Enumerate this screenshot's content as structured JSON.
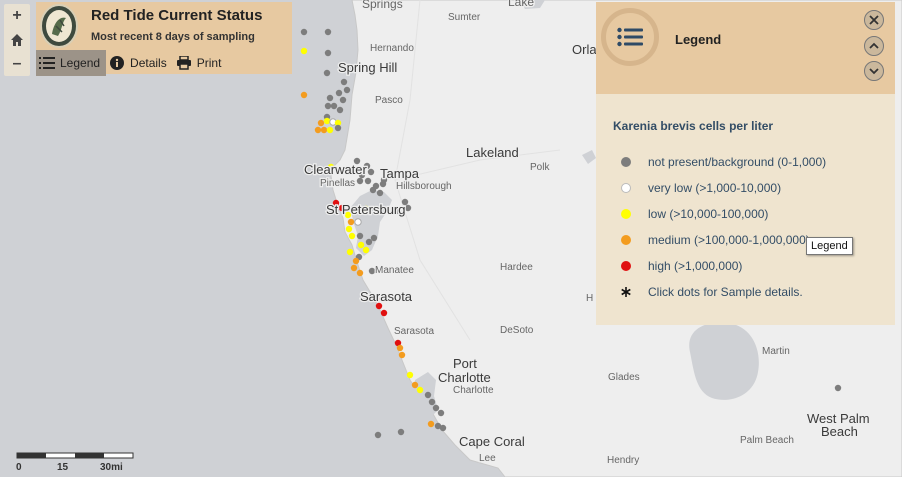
{
  "header": {
    "title": "Red Tide Current Status",
    "subtitle": "Most recent 8 days of sampling",
    "tabs": [
      {
        "label": "Legend",
        "icon": "list-icon",
        "active": true
      },
      {
        "label": "Details",
        "icon": "info-icon",
        "active": false
      },
      {
        "label": "Print",
        "icon": "printer-icon",
        "active": false
      }
    ]
  },
  "zoom": {
    "in": "+",
    "home_icon": "home-icon",
    "out": "–"
  },
  "legend": {
    "title": "Legend",
    "species": "Karenia brevis cells per liter",
    "items": [
      {
        "label": "not present/background (0-1,000)",
        "color": "#7d7d7d"
      },
      {
        "label": "very low (>1,000-10,000)",
        "color": "#ffffff"
      },
      {
        "label": "low (>10,000-100,000)",
        "color": "#ffff00"
      },
      {
        "label": "medium (>100,000-1,000,000)",
        "color": "#f39c1f"
      },
      {
        "label": "high (>1,000,000)",
        "color": "#e01010"
      }
    ],
    "note": "Click dots for Sample details.",
    "tooltip": "Legend"
  },
  "scale": {
    "labels": [
      "0",
      "15",
      "30mi"
    ]
  },
  "places": [
    {
      "name": "Springs",
      "cls": "mid"
    },
    {
      "name": "Sumter",
      "cls": "small"
    },
    {
      "name": "Lake",
      "cls": "mid"
    },
    {
      "name": "Hernando",
      "cls": "small"
    },
    {
      "name": "Spring Hill",
      "cls": "big"
    },
    {
      "name": "Orla",
      "cls": "big"
    },
    {
      "name": "Pasco",
      "cls": "small"
    },
    {
      "name": "Lakeland",
      "cls": "big"
    },
    {
      "name": "Clearwater",
      "cls": "big"
    },
    {
      "name": "Tampa",
      "cls": "big"
    },
    {
      "name": "Pinellas",
      "cls": "small"
    },
    {
      "name": "Hillsborough",
      "cls": "small"
    },
    {
      "name": "Polk",
      "cls": "small"
    },
    {
      "name": "St Petersburg",
      "cls": "big"
    },
    {
      "name": "Manatee",
      "cls": "small"
    },
    {
      "name": "Hardee",
      "cls": "small"
    },
    {
      "name": "Sarasota",
      "cls": "big"
    },
    {
      "name": "Sarasota",
      "cls": "small"
    },
    {
      "name": "DeSoto",
      "cls": "small"
    },
    {
      "name": "Port",
      "cls": "big"
    },
    {
      "name": "Charlotte",
      "cls": "big"
    },
    {
      "name": "Charlotte",
      "cls": "small"
    },
    {
      "name": "Glades",
      "cls": "small"
    },
    {
      "name": "Martin",
      "cls": "small"
    },
    {
      "name": "West Palm",
      "cls": "big"
    },
    {
      "name": "Beach",
      "cls": "big"
    },
    {
      "name": "Palm Beach",
      "cls": "small"
    },
    {
      "name": "Cape Coral",
      "cls": "big"
    },
    {
      "name": "Lee",
      "cls": "small"
    },
    {
      "name": "Hendry",
      "cls": "small"
    },
    {
      "name": "H",
      "cls": "small"
    }
  ]
}
